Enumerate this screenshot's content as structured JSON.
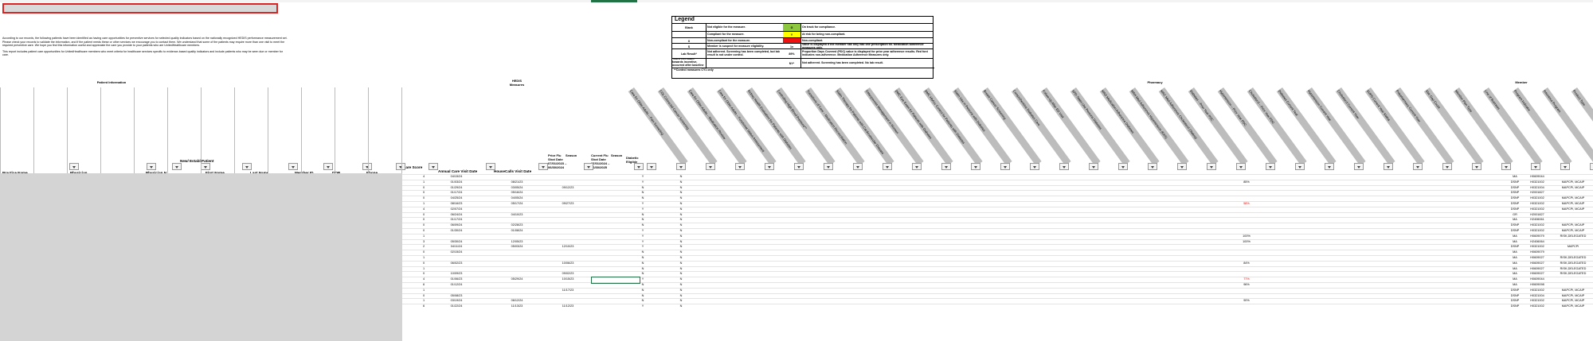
{
  "intro": "According to our records, the following patients have been identified as having care opportunities for preventive services for selected quality indicators based on the nationally recognized HEDIS performance measurement set. Please check your records to validate the information, and if the patient needs these or other services we encourage you to contact them. We understand that some of the patients may require more than one visit to meet the required preventive care. We hope you find this information useful and appreciate the care you provide to your patients who are UnitedHealthcare members.",
  "intro2": "This report includes patient care opportunities for UnitedHealthcare members who meet criteria for healthcare services specific to evidence-based quality indicators and include patients who may be seen due or member for care.",
  "legend": {
    "title": "Legend",
    "rows": [
      {
        "k": "Blank",
        "d": "Not eligible for the measure.",
        "k2": "G",
        "c2": "#8dc63f",
        "d2": "On track for compliance."
      },
      {
        "k": "",
        "d": "Compliant for the measure.",
        "k2": "Y",
        "c2": "#ffff00",
        "d2": "At risk for being non-compliant."
      },
      {
        "k": "X",
        "d": "Non-compliant for the measure.",
        "k2": "",
        "c2": "#ee1111",
        "d2": "Non-compliant."
      },
      {
        "k": "S",
        "d": "Member is suspect for measure eligibility.",
        "k2": "1x",
        "c2": "#ffffff",
        "d2": "Value is displayed if the member has only had one prescription fill. Medication adherence measures only."
      },
      {
        "k": "Lab Result*",
        "d": "Not adherent. Screening has been completed, but lab result is not under control.",
        "k2": "89%",
        "c2": "#ffffff",
        "d2": "Proportion Days Covered (PDC) value is displayed for prior year adherence results. Red font indicates non-adherence. Medication Adherence Measures only."
      },
      {
        "k": "*Does not count towards incentive, occurred after baseline was set",
        "d": "",
        "k2": "NY*",
        "c2": "#ffffff",
        "d2": "Not adherent. Screening has been completed. No lab result."
      }
    ],
    "note": "**Control measures CY1 only"
  },
  "groups": {
    "patient_info": "Patient Information",
    "hedis": "HEDIS Measures",
    "pharmacy": "Pharmacy",
    "member": "Member"
  },
  "headers": [
    "Practice Name",
    "Physician",
    "Physician N",
    "New/ Establ Patient",
    "First Name",
    "Last Name",
    "Member ID",
    "DOB",
    "Phone",
    "Care Score",
    "Annual Care Visit Date",
    "HouseCalls Visit Date",
    "Prior Flu Shot Date 07/01/2023 – 06/30/2024",
    "Season",
    "Current Flu Shot Date 07/01/2024 – 06/30/2025",
    "Season",
    "Diabetic Eligible"
  ],
  "rot_headers": [
    "Care for Older Adults – Pain Screening",
    "COL Colorectal Cancer Screening",
    "Care for Older Adults – Medication Review",
    "Care for Older Adults – Functional Status Assessment",
    "Kidney Health Evaluation for Patients with Diabetes",
    "Controlling High Blood Pressure**",
    "Transitions of Care – Medication Reconciliation",
    "Statin Therapy for Patients with Cardiovascular Disease",
    "Osteoporosis Management in Women",
    "DMC Eye Exam for Patients with Diabetes",
    "DMC HbA1c Control for Patients with Diabetes",
    "Statin Use in Persons with Diabetes",
    "Breast Cancer Screening",
    "Comprehensive Diabetes Care",
    "Follow-Up After ED Visit",
    "SPD Statin Use Persons Diabetes",
    "MAD Medication Adherence Diabetes",
    "MAH Med Adherence Hypertension (RAS)",
    "MAC Med Adherence Cholesterol (Statins)",
    "Diabetes – Prior Year PDC",
    "Hypertension – Prior Year PDC",
    "Cholesterol – Prior Year PDC",
    "Diabetes Current Year",
    "Hypertension Current Year",
    "Cholesterol Current Year",
    "SUPD Current Year Status",
    "Polypharmacy Current Year",
    "Star Gap Count",
    "Member Plan Type",
    "Line of Business",
    "Program Indicator",
    "Insurance Program",
    "Product Type"
  ],
  "rows": [
    {
      "score": "4",
      "acv": "04/15/24",
      "hcv": "",
      "prior": "",
      "cur": "",
      "dia": "Y",
      "c1": "N",
      "p": "",
      "t": "MA",
      "id": "H0609044",
      "prog": ""
    },
    {
      "score": "1",
      "acv": "01/03/24",
      "hcv": "08/21/23",
      "prior": "",
      "cur": "",
      "dia": "Y",
      "c1": "N",
      "p": "85%",
      "t": "DSNP",
      "id": "H0321002",
      "prog": "MAPCPi, MCAIP"
    },
    {
      "score": "0",
      "acv": "01/29/24",
      "hcv": "03/05/24",
      "prior": "09/12/23",
      "cur": "",
      "dia": "N",
      "c1": "N",
      "p": "",
      "t": "DSNP",
      "id": "H0321004",
      "prog": "MAPCPi, MCAIP"
    },
    {
      "score": "0",
      "acv": "01/17/24",
      "hcv": "05/16/24",
      "prior": "",
      "cur": "",
      "dia": "N",
      "c1": "N",
      "p": "",
      "t": "DSNP",
      "id": "H2001827",
      "prog": ""
    },
    {
      "score": "0",
      "acv": "04/25/24",
      "hcv": "04/05/24",
      "prior": "",
      "cur": "",
      "dia": "N",
      "c1": "N",
      "p": "",
      "t": "DSNP",
      "id": "H0321002",
      "prog": "MAPCPi, MCAIP"
    },
    {
      "score": "1",
      "acv": "08/16/23",
      "hcv": "05/17/24",
      "prior": "09/27/23",
      "cur": "",
      "dia": "Y",
      "c1": "N",
      "p": "58%",
      "t": "DSNP",
      "id": "H0321002",
      "prog": "MAPCPi, MCAIP"
    },
    {
      "score": "4",
      "acv": "02/07/24",
      "hcv": "",
      "prior": "",
      "cur": "",
      "dia": "Y",
      "c1": "N",
      "p": "",
      "t": "DSNP",
      "id": "H0321002",
      "prog": "MAPCPi, MCAIP"
    },
    {
      "score": "0",
      "acv": "06/24/24",
      "hcv": "04/10/23",
      "prior": "",
      "cur": "",
      "dia": "N",
      "c1": "N",
      "p": "",
      "t": "GR",
      "id": "H2001827",
      "prog": ""
    },
    {
      "score": "0",
      "acv": "01/17/24",
      "hcv": "",
      "prior": "",
      "cur": "",
      "dia": "N",
      "c1": "N",
      "p": "",
      "t": "MA",
      "id": "H2406061",
      "prog": ""
    },
    {
      "score": "0",
      "acv": "06/09/24",
      "hcv": "02/28/23",
      "prior": "",
      "cur": "",
      "dia": "N",
      "c1": "N",
      "p": "",
      "t": "DSNP",
      "id": "H0321002",
      "prog": "MAPCPi, MCAIP"
    },
    {
      "score": "0",
      "acv": "01/30/24",
      "hcv": "01/08/24",
      "prior": "",
      "cur": "",
      "dia": "Y",
      "c1": "N",
      "p": "",
      "t": "DSNP",
      "id": "H0321002",
      "prog": "MAPCPi, MCAIP"
    },
    {
      "score": "1",
      "acv": "",
      "hcv": "",
      "prior": "",
      "cur": "",
      "dia": "Y",
      "c1": "N",
      "p": "100%",
      "t": "MA",
      "id": "H0609079",
      "prog": "RISK,DELEGATED"
    },
    {
      "score": "3",
      "acv": "05/30/24",
      "hcv": "12/05/23",
      "prior": "",
      "cur": "",
      "dia": "Y",
      "c1": "N",
      "p": "100%",
      "t": "MA",
      "id": "H2406064",
      "prog": ""
    },
    {
      "score": "2",
      "acv": "04/11/24",
      "hcv": "05/03/24",
      "prior": "12/10/23",
      "cur": "",
      "dia": "Y",
      "c1": "N",
      "p": "",
      "t": "DSNP",
      "id": "H0321002",
      "prog": "MAPCPi"
    },
    {
      "score": "0",
      "acv": "02/15/24",
      "hcv": "",
      "prior": "",
      "cur": "",
      "dia": "N",
      "c1": "N",
      "p": "",
      "t": "MA",
      "id": "H0609079",
      "prog": ""
    },
    {
      "score": "1",
      "acv": "",
      "hcv": "",
      "prior": "",
      "cur": "",
      "dia": "N",
      "c1": "N",
      "p": "",
      "t": "MA",
      "id": "H0609027",
      "prog": "RISK,DELEGATED"
    },
    {
      "score": "0",
      "acv": "06/02/23",
      "hcv": "",
      "prior": "10/06/23",
      "cur": "",
      "dia": "N",
      "c1": "N",
      "p": "84%",
      "t": "MA",
      "id": "H0609027",
      "prog": "RISK,DELEGATED"
    },
    {
      "score": "1",
      "acv": "",
      "hcv": "",
      "prior": "",
      "cur": "",
      "dia": "N",
      "c1": "N",
      "p": "",
      "t": "MA",
      "id": "H0609027",
      "prog": "RISK,DELEGATED"
    },
    {
      "score": "0",
      "acv": "10/09/23",
      "hcv": "",
      "prior": "09/02/23",
      "cur": "",
      "dia": "N",
      "c1": "N",
      "p": "",
      "t": "MA",
      "id": "H0609027",
      "prog": "RISK,DELEGATED"
    },
    {
      "score": "4",
      "acv": "01/06/23",
      "hcv": "05/29/24",
      "prior": "10/15/23",
      "cur": "",
      "dia": "Y",
      "c1": "N",
      "p": "77%",
      "t": "MA",
      "id": "H0609044",
      "prog": ""
    },
    {
      "score": "6",
      "acv": "01/12/24",
      "hcv": "",
      "prior": "",
      "cur": "",
      "dia": "N",
      "c1": "N",
      "p": "96%",
      "t": "MA",
      "id": "H0609098",
      "prog": ""
    },
    {
      "score": "1",
      "acv": "",
      "hcv": "",
      "prior": "11/17/23",
      "cur": "",
      "dia": "N",
      "c1": "N",
      "p": "",
      "t": "DSNP",
      "id": "H0321002",
      "prog": "MAPCPi, MCAIP"
    },
    {
      "score": "0",
      "acv": "05/08/23",
      "hcv": "",
      "prior": "",
      "cur": "",
      "dia": "N",
      "c1": "N",
      "p": "",
      "t": "DSNP",
      "id": "H0321004",
      "prog": "MAPCPi, MCAIP"
    },
    {
      "score": "1",
      "acv": "03/19/24",
      "hcv": "06/12/24",
      "prior": "",
      "cur": "",
      "dia": "N",
      "c1": "N",
      "p": "90%",
      "t": "DSNP",
      "id": "H0321002",
      "prog": "MAPCPi, MCAIP"
    },
    {
      "score": "6",
      "acv": "01/22/24",
      "hcv": "11/13/23",
      "prior": "11/12/23",
      "cur": "",
      "dia": "Y",
      "c1": "N",
      "p": "",
      "t": "DSNP",
      "id": "H0321002",
      "prog": "MAPCPi, MCAIP"
    }
  ]
}
